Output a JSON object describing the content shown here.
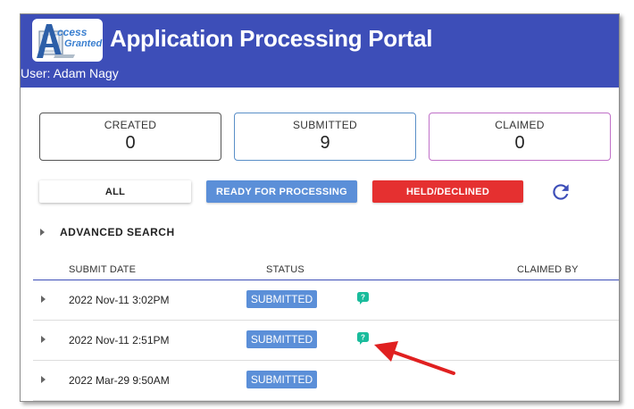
{
  "header": {
    "logo_word1": "ccess",
    "logo_word2": "Granted",
    "title": "Application Processing Portal",
    "user": "User: Adam Nagy"
  },
  "counts": [
    {
      "label": "CREATED",
      "value": "0"
    },
    {
      "label": "SUBMITTED",
      "value": "9"
    },
    {
      "label": "CLAIMED",
      "value": "0"
    }
  ],
  "filters": {
    "all": "ALL",
    "ready": "READY FOR PROCESSING",
    "held": "HELD/DECLINED"
  },
  "advanced_search": "ADVANCED SEARCH",
  "table": {
    "columns": {
      "submit_date": "SUBMIT DATE",
      "status": "STATUS",
      "claimed_by": "CLAIMED BY"
    },
    "rows": [
      {
        "date": "2022 Nov-11 3:02PM",
        "status": "SUBMITTED",
        "has_note": true
      },
      {
        "date": "2022 Nov-11 2:51PM",
        "status": "SUBMITTED",
        "has_note": true
      },
      {
        "date": "2022 Mar-29 9:50AM",
        "status": "SUBMITTED",
        "has_note": false
      }
    ]
  },
  "colors": {
    "header_bg": "#3d4eb8",
    "ready_button": "#5b8fd8",
    "held_button": "#e53030",
    "status_pill": "#5b8fd8",
    "note_icon": "#1abc9c",
    "annotation_arrow": "#e02020"
  },
  "icons": {
    "refresh": "refresh-icon",
    "row_expand": "caret-right-icon",
    "note": "chat-bubble-icon"
  }
}
